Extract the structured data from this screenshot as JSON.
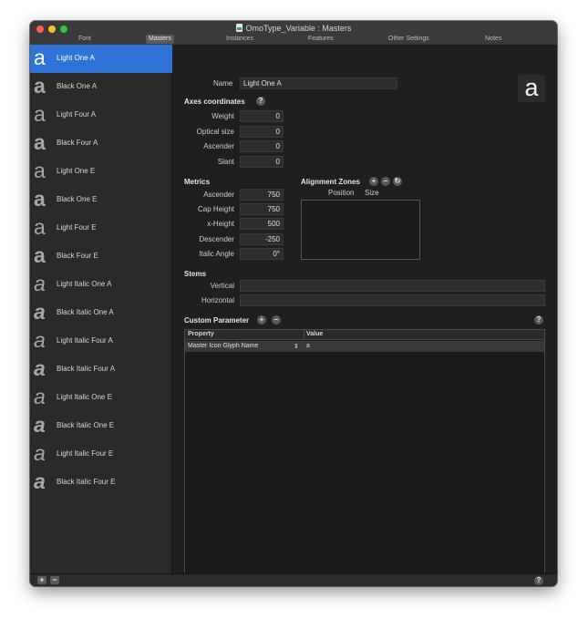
{
  "window": {
    "title": "OmoType_Variable : Masters",
    "tabs": [
      "Font",
      "Masters",
      "Instances",
      "Features",
      "Other Settings",
      "Notes"
    ],
    "active_tab": "Masters"
  },
  "sidebar": {
    "items": [
      {
        "label": "Light One A",
        "glyph": "a"
      },
      {
        "label": "Black One A",
        "glyph": "a"
      },
      {
        "label": "Light Four A",
        "glyph": "a"
      },
      {
        "label": "Black Four A",
        "glyph": "a"
      },
      {
        "label": "Light One E",
        "glyph": "a"
      },
      {
        "label": "Black One E",
        "glyph": "a"
      },
      {
        "label": "Light Four E",
        "glyph": "a"
      },
      {
        "label": "Black Four E",
        "glyph": "a"
      },
      {
        "label": "Light Italic One A",
        "glyph": "a"
      },
      {
        "label": "Black Italic One A",
        "glyph": "a"
      },
      {
        "label": "Light Italic Four A",
        "glyph": "a"
      },
      {
        "label": "Black Italic Four A",
        "glyph": "a"
      },
      {
        "label": "Light Italic One E",
        "glyph": "a"
      },
      {
        "label": "Black Italic One E",
        "glyph": "a"
      },
      {
        "label": "Light Italic Four E",
        "glyph": "a"
      },
      {
        "label": "Black Italic Four E",
        "glyph": "a"
      }
    ],
    "selected_index": 0,
    "selected_color": "#2f73d8"
  },
  "main": {
    "name_label": "Name",
    "name_value": "Light One A",
    "preview_glyph": "a",
    "axes": {
      "header": "Axes coordinates",
      "help": "?",
      "fields": [
        {
          "label": "Weight",
          "value": "0"
        },
        {
          "label": "Optical size",
          "value": "0"
        },
        {
          "label": "Ascender",
          "value": "0"
        },
        {
          "label": "Slant",
          "value": "0"
        }
      ]
    },
    "metrics": {
      "header": "Metrics",
      "fields": [
        {
          "label": "Ascender",
          "value": "750"
        },
        {
          "label": "Cap Height",
          "value": "750"
        },
        {
          "label": "x-Height",
          "value": "500"
        },
        {
          "label": "Descender",
          "value": "-250"
        },
        {
          "label": "Italic Angle",
          "value": "0°"
        }
      ]
    },
    "alignment_zones": {
      "header": "Alignment Zones",
      "col_position": "Position",
      "col_size": "Size",
      "add": "+",
      "remove": "−",
      "refresh": "↻"
    },
    "stems": {
      "header": "Stems",
      "vertical_label": "Vertical",
      "vertical_value": "",
      "horizontal_label": "Horizontal",
      "horizontal_value": ""
    },
    "custom_parameter": {
      "header": "Custom Parameter",
      "add": "+",
      "remove": "−",
      "help": "?",
      "col_property": "Property",
      "col_value": "Value",
      "rows": [
        {
          "property": "Master Icon Glyph Name",
          "value": "a"
        }
      ]
    }
  },
  "bottombar": {
    "add": "+",
    "remove": "−",
    "help": "?"
  }
}
